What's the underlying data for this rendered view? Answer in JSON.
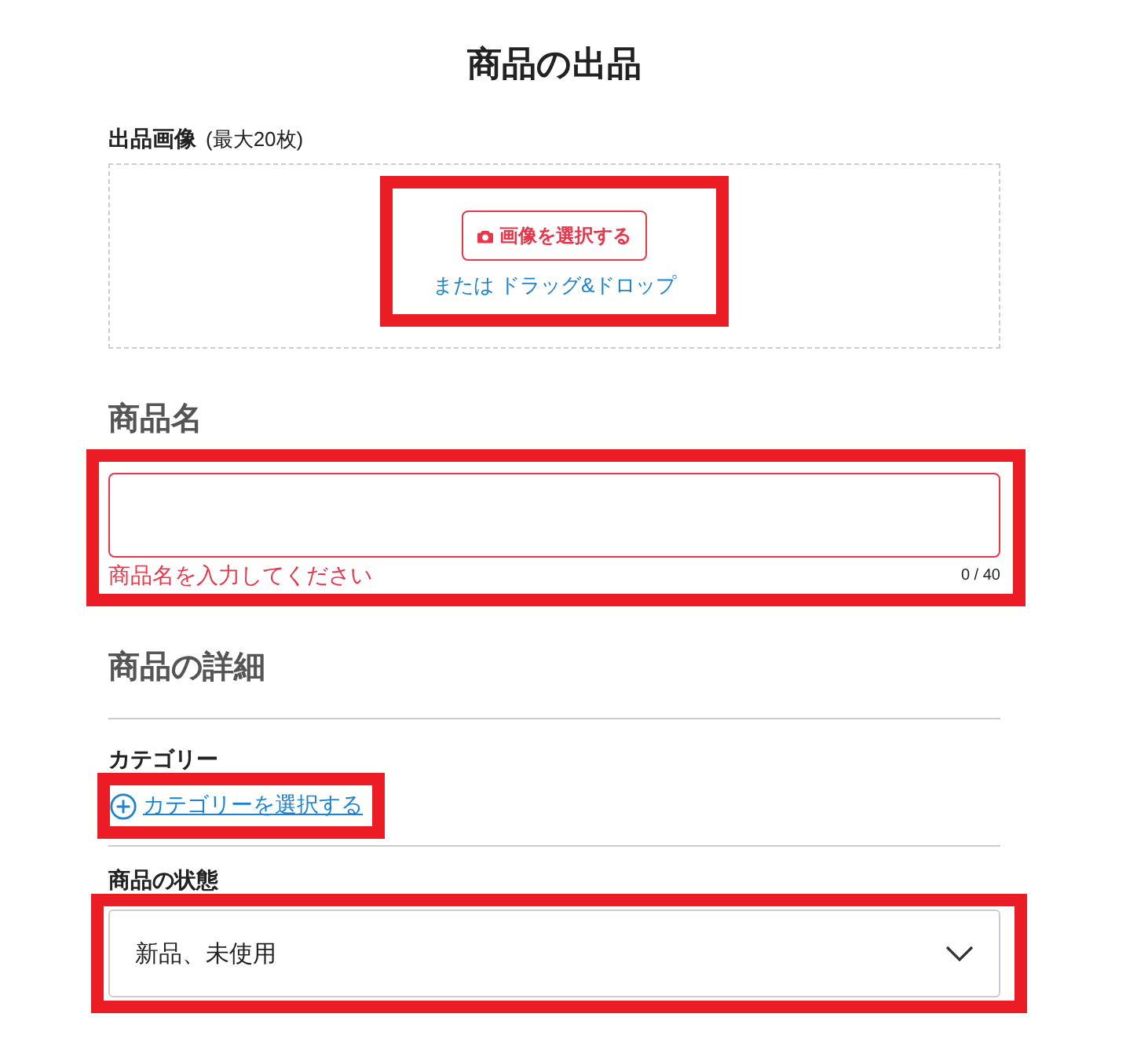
{
  "page_title": "商品の出品",
  "images": {
    "label": "出品画像",
    "note": "(最大20枚)",
    "button": "画像を選択する",
    "hint": "または ドラッグ&ドロップ",
    "highlighted": true
  },
  "name": {
    "heading": "商品名",
    "error": "商品名を入力してください",
    "counter": "0 / 40",
    "invalid": true,
    "highlighted": true
  },
  "details": {
    "heading": "商品の詳細",
    "category": {
      "label": "カテゴリー",
      "link": "カテゴリーを選択する",
      "highlighted": true
    },
    "condition": {
      "label": "商品の状態",
      "value": "新品、未使用",
      "highlighted": true
    }
  }
}
